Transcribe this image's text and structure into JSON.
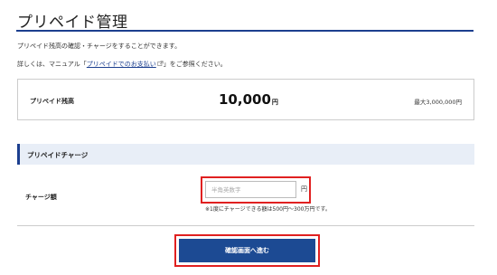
{
  "page": {
    "title": "プリペイド管理"
  },
  "intro": {
    "text": "プリペイド残高の確認・チャージをすることができます。"
  },
  "details": {
    "prefix": "詳しくは、マニュアル「",
    "link_text": "プリペイドでのお支払い",
    "suffix": "」をご参照ください。"
  },
  "balance": {
    "label": "プリペイド残高",
    "amount": "10,000",
    "unit": "円",
    "max": "最大3,000,000円"
  },
  "charge": {
    "section_title": "プリペイドチャージ",
    "label": "チャージ額",
    "input_value": "",
    "input_placeholder": "半角英数字",
    "unit": "円",
    "note": "※1度にチャージできる額は500円〜300万円です。",
    "confirm_button": "確認画面へ進む"
  },
  "colors": {
    "accent": "#1c3f8f",
    "button": "#1c4a93",
    "highlight": "#e02020",
    "section_bg": "#e8eef7"
  }
}
